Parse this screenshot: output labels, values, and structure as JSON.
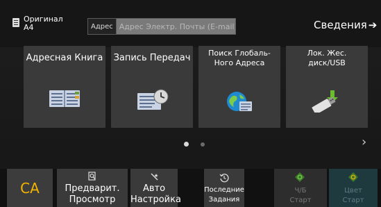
{
  "header": {
    "original_line1": "Оригинал",
    "original_line2": "А4",
    "address_label": "Адрес",
    "address_placeholder": "Адрес Электр. Почты (E-mail)",
    "info_label": "Сведения",
    "info_arrow": "➔"
  },
  "tiles": [
    {
      "label": "Адресная Книга"
    },
    {
      "label": "Запись Передач"
    },
    {
      "label_line1": "Поиск Глобаль-",
      "label_line2": "Ного Адреса"
    },
    {
      "label_line1": "Лок. Жес.",
      "label_line2": "диск/USB"
    }
  ],
  "pager": {
    "pages": 2,
    "current": 1,
    "next_arrow": "›"
  },
  "bottom": {
    "ca_label": "CA",
    "preview_line1": "Предварит.",
    "preview_line2": "Просмотр",
    "auto_line1": "Авто",
    "auto_line2": "Настройка",
    "recent_line1": "Последние",
    "recent_line2": "Задания",
    "bw_line1": "Ч/Б",
    "bw_line2": "Старт",
    "color_line1": "Цвет",
    "color_line2": "Старт"
  },
  "colors": {
    "accent": "#f4b400",
    "tile": "#3a3a3a",
    "background": "#161616"
  }
}
